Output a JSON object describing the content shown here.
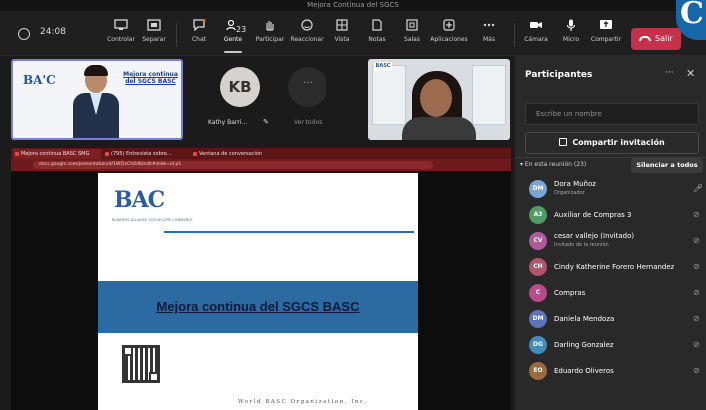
{
  "window": {
    "title": "Mejora Continua del SGCS"
  },
  "toolbar": {
    "timer": "24:08",
    "participant_count": "23",
    "buttons": [
      {
        "label": "Controlar"
      },
      {
        "label": "Separar"
      },
      {
        "label": "Chat"
      },
      {
        "label": "Gente"
      },
      {
        "label": "Participar"
      },
      {
        "label": "Reaccionar"
      },
      {
        "label": "Vista"
      },
      {
        "label": "Notas"
      },
      {
        "label": "Salas"
      },
      {
        "label": "Aplicaciones"
      },
      {
        "label": "Más"
      },
      {
        "label": "Cámara"
      },
      {
        "label": "Micro"
      },
      {
        "label": "Compartir"
      }
    ],
    "leave_label": "Salir",
    "badge_letter": "C"
  },
  "gallery": {
    "speaker_slide_logo": "BA'C",
    "speaker_slide_title": "Mejora continua del SGCS BASC",
    "kb_initials": "KB",
    "kb_name": "Kathy Barri...",
    "more_label": "Ver todos",
    "woman_logo": "BASC"
  },
  "share": {
    "tabs": [
      "Mejora continua BASC SMG",
      "(795) Entrevista sobre...",
      "Ventana de conversación"
    ],
    "url": "docs.google.com/presentation/d/1Wf2sCh0dK/edit#slide=id.p1",
    "slide": {
      "logo": "BAC",
      "logo_sub": "BUSINESS ALLIANCE FOR SECURE COMMERCE",
      "title": "Mejora continua del SGCS BASC",
      "footer": "World BASC Organization, Inc."
    }
  },
  "panel": {
    "title": "Participantes",
    "search_placeholder": "Escribe un nombre",
    "invite_label": "Compartir invitación",
    "section_label": "En esta reunión (23)",
    "mute_all_label": "Silenciar a todos",
    "participants": [
      {
        "initials": "DM",
        "name": "Dora Muñoz",
        "sub": "Organizador",
        "color": "#7aa6d6",
        "mic": "on"
      },
      {
        "initials": "A3",
        "name": "Auxiliar de Compras 3",
        "sub": "",
        "color": "#4f9b62",
        "mic": "muted"
      },
      {
        "initials": "CV",
        "name": "cesar vallejo (Invitado)",
        "sub": "Invitado de la reunión",
        "color": "#b05a9c",
        "mic": "muted"
      },
      {
        "initials": "CH",
        "name": "Cindy Katherine Forero Hernandez",
        "sub": "",
        "color": "#b0556d",
        "mic": "muted"
      },
      {
        "initials": "C",
        "name": "Compras",
        "sub": "",
        "color": "#b64d8a",
        "mic": "muted"
      },
      {
        "initials": "DM",
        "name": "Daniela Mendoza",
        "sub": "",
        "color": "#5b73b8",
        "mic": "muted"
      },
      {
        "initials": "DG",
        "name": "Darling Gonzalez",
        "sub": "",
        "color": "#3f8db8",
        "mic": "muted"
      },
      {
        "initials": "EO",
        "name": "Eduardo Oliveros",
        "sub": "",
        "color": "#9c6a3f",
        "mic": "muted"
      }
    ]
  },
  "icons": {
    "shield": "shield-icon",
    "mic": "mic-icon",
    "mic_off": "mic-off-icon",
    "more": "more-icon",
    "close": "close-icon"
  }
}
